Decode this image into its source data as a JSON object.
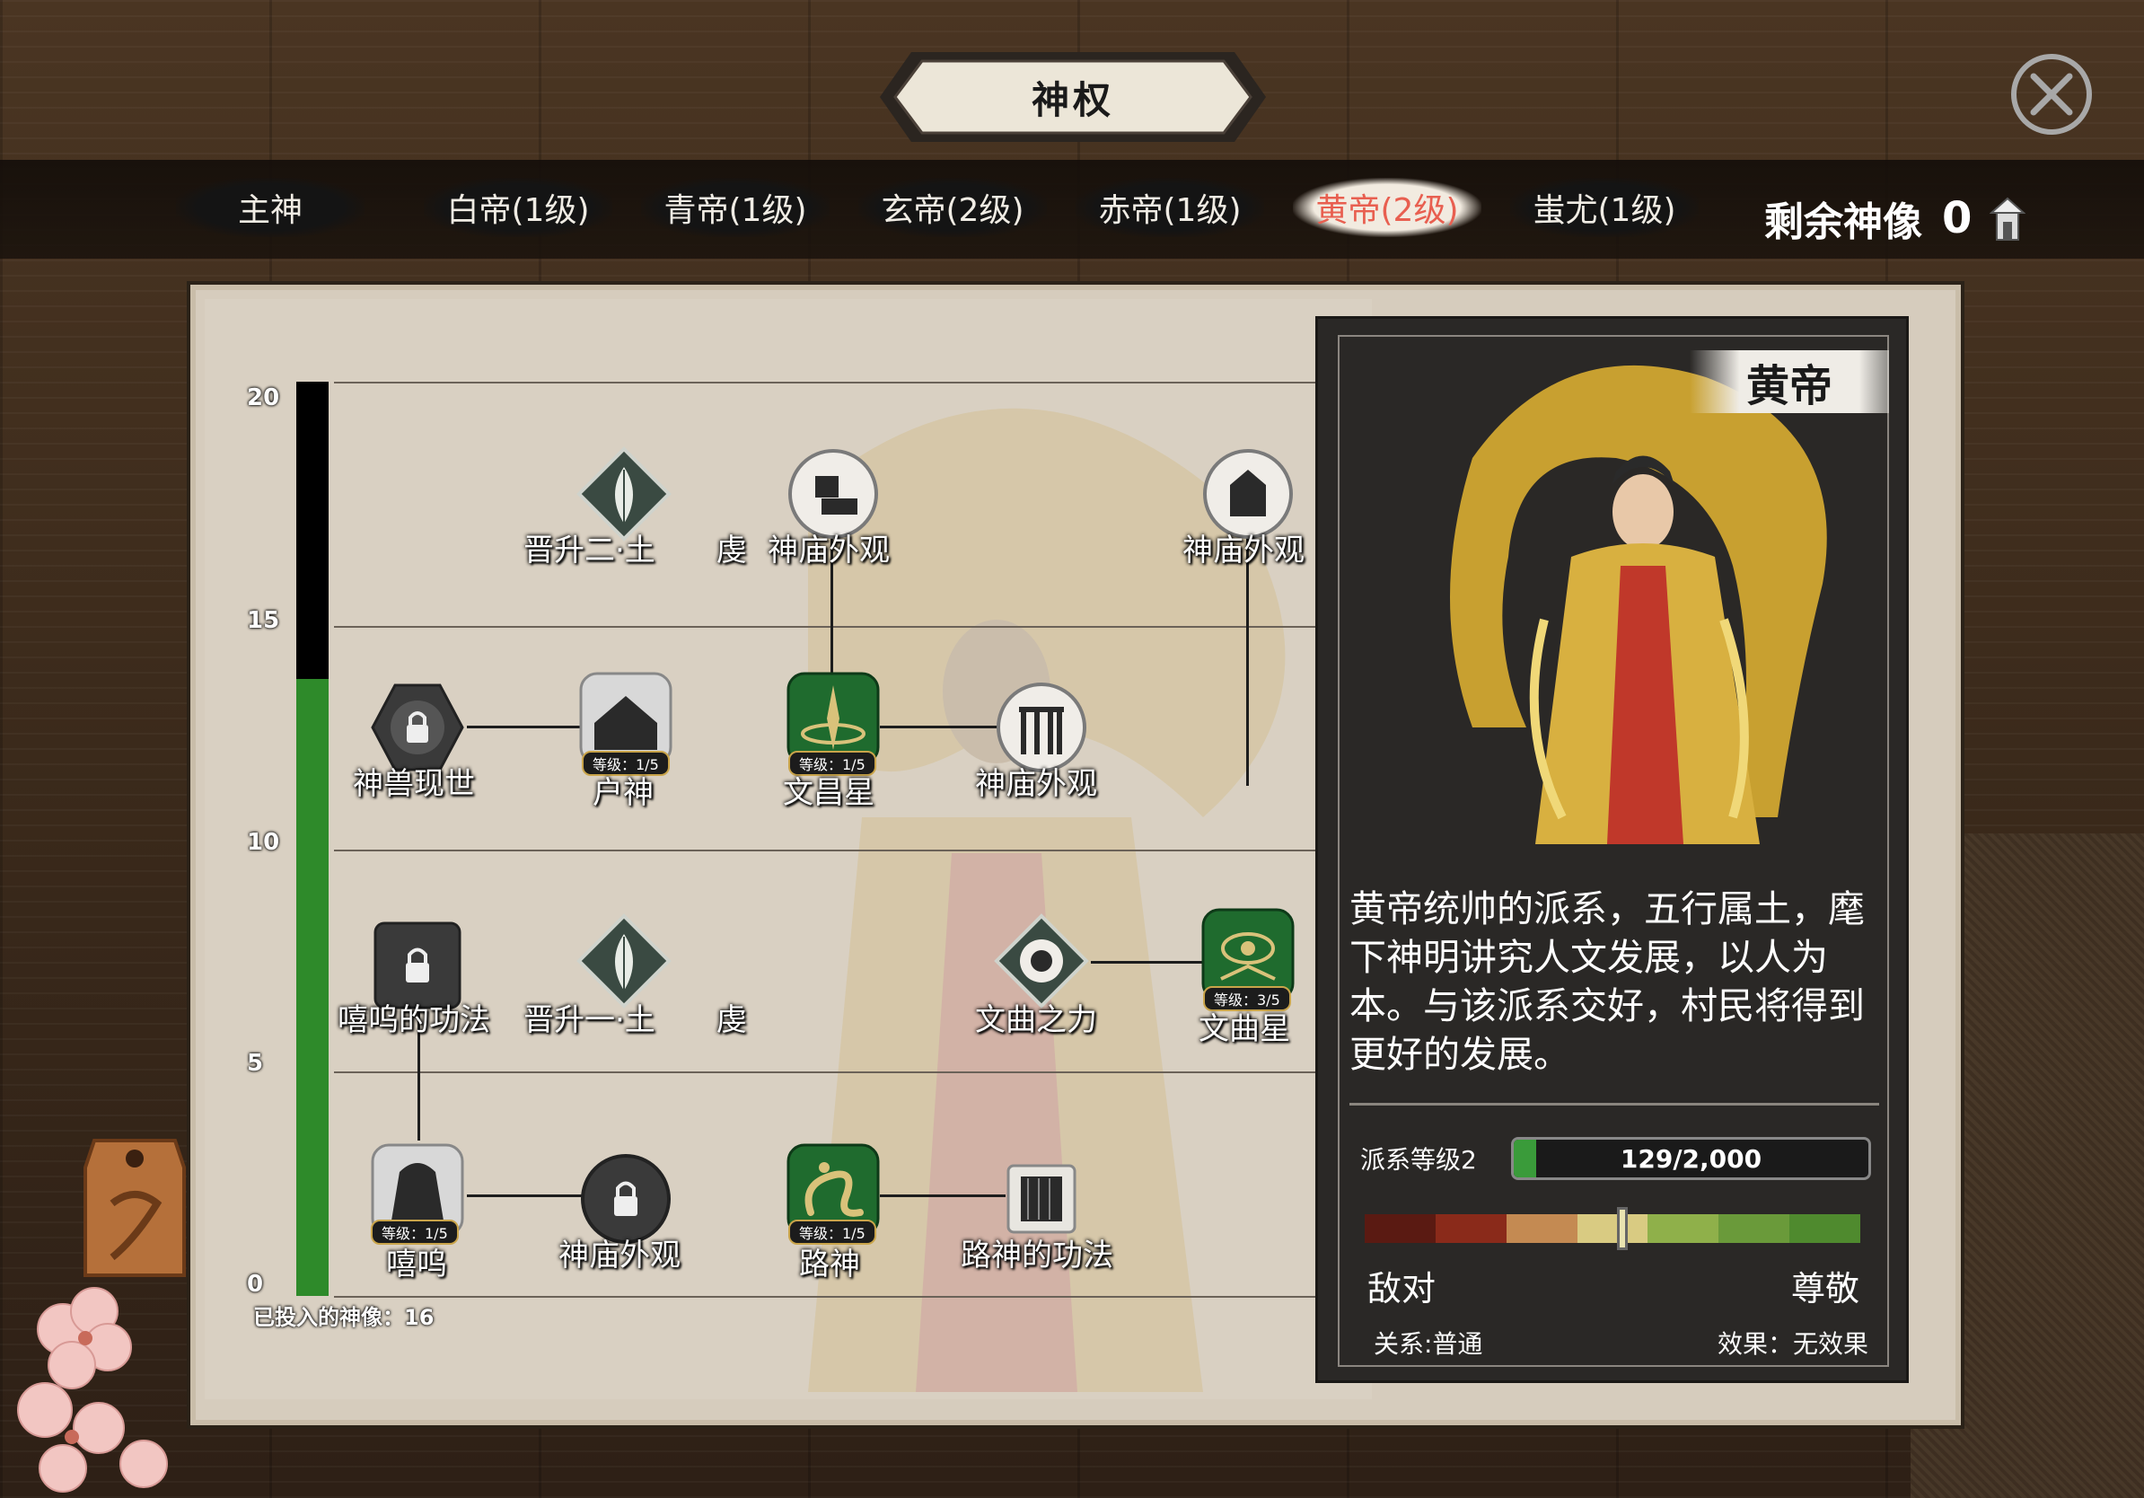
{
  "title": "神权",
  "tabs": [
    {
      "label": "主神",
      "active": false
    },
    {
      "label": "白帝(1级)",
      "active": false
    },
    {
      "label": "青帝(1级)",
      "active": false
    },
    {
      "label": "玄帝(2级)",
      "active": false
    },
    {
      "label": "赤帝(1级)",
      "active": false
    },
    {
      "label": "黄帝(2级)",
      "active": true
    },
    {
      "label": "蚩尤(1级)",
      "active": false
    }
  ],
  "remaining": {
    "label": "剩余神像",
    "value": "0"
  },
  "tree": {
    "y_ticks": [
      "20",
      "15",
      "10",
      "5",
      "0"
    ],
    "progress_max": 20,
    "progress_value": 13.5,
    "invested_label": "已投入的神像：16",
    "nodes": {
      "ascend2": {
        "label": "晋升二·土　　虔"
      },
      "temple1": {
        "label": "神庙外观"
      },
      "temple2": {
        "label": "神庙外观"
      },
      "beast": {
        "label": "神兽现世"
      },
      "hushen": {
        "label": "户神",
        "level": "等级：1/5"
      },
      "wenchang": {
        "label": "文昌星",
        "level": "等级：1/5"
      },
      "temple3": {
        "label": "神庙外观"
      },
      "xiwu_art": {
        "label": "嘻呜的功法"
      },
      "ascend1": {
        "label": "晋升一·土　　虔"
      },
      "wenqu_power": {
        "label": "文曲之力"
      },
      "wenqu": {
        "label": "文曲星",
        "level": "等级：3/5"
      },
      "xiwu": {
        "label": "嘻呜",
        "level": "等级：1/5"
      },
      "temple4": {
        "label": "神庙外观"
      },
      "lushen": {
        "label": "路神",
        "level": "等级：1/5"
      },
      "lushen_art": {
        "label": "路神的功法"
      }
    }
  },
  "info": {
    "name": "黄帝",
    "description": "黄帝统帅的派系，五行属土，麾下神明讲究人文发展，以人为本。与该派系交好，村民将得到更好的发展。",
    "level_label": "派系等级2",
    "xp_text": "129/2,000",
    "xp_current": 129,
    "xp_max": 2000,
    "relation_position": 0.52,
    "relation_colors": [
      "#5a1a12",
      "#8a2a1a",
      "#c48a52",
      "#d9cb82",
      "#8fb04a",
      "#6a9a3a",
      "#4f8a2e"
    ],
    "enemy_label": "敌对",
    "respect_label": "尊敬",
    "relation_text": "关系:普通",
    "effect_text": "效果：无效果"
  }
}
